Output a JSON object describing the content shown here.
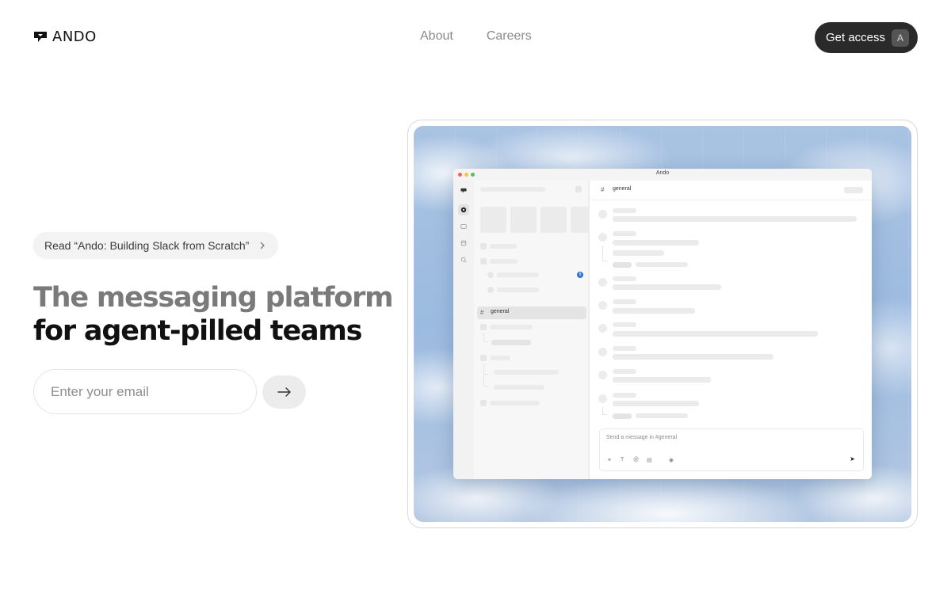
{
  "header": {
    "brand": "ANDO",
    "nav": [
      "About",
      "Careers"
    ],
    "cta_label": "Get access",
    "cta_shortcut": "A"
  },
  "hero": {
    "announcement": "Read “Ando: Building Slack from Scratch”",
    "headline_line1": "The messaging platform",
    "headline_line2": "for agent-pilled teams",
    "email_placeholder": "Enter your email"
  },
  "preview": {
    "window_title": "Ando",
    "selected_channel": "general",
    "main_channel": "general",
    "unread_count": "8",
    "composer_placeholder": "Send a message in #general"
  },
  "colors": {
    "accent_dark": "#2a2a2a",
    "badge_blue": "#2f6fd8",
    "sky": "#a9c3e2"
  },
  "icons": {
    "logo": "ando-logo-icon",
    "announce_chevron": "chevron-right-icon",
    "submit": "arrow-right-icon"
  }
}
